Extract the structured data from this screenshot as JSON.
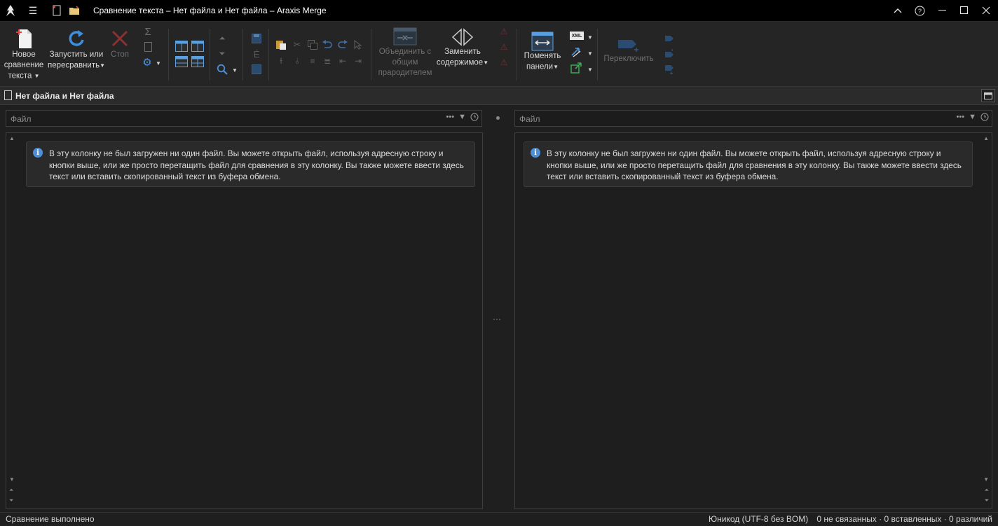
{
  "window": {
    "title": "Сравнение текста – Нет файла и Нет файла – Araxis Merge"
  },
  "ribbon": {
    "new_comparison": "Новое сравнение текста",
    "new_comparison_l1": "Новое",
    "new_comparison_l2": "сравнение",
    "new_comparison_l3": "текста",
    "rerun_l1": "Запустить или",
    "rerun_l2": "пересравнить",
    "stop": "Стоп",
    "merge_l1": "Объединить с",
    "merge_l2": "общим",
    "merge_l3": "прародителем",
    "replace_l1": "Заменить",
    "replace_l2": "содержимое",
    "swap_l1": "Поменять",
    "swap_l2": "панели",
    "switch": "Переключить",
    "xml_badge": "XML"
  },
  "document": {
    "tab_title": "Нет файла и Нет файла"
  },
  "panes": {
    "left": {
      "address_placeholder": "Файл",
      "notice_l1": "В эту колонку не был загружен ни один файл. Вы можете открыть файл, используя адресную строку и",
      "notice_l2": "кнопки выше, или же просто перетащить файл для сравнения в эту колонку. Вы также можете ввести здесь",
      "notice_l3": "текст или вставить скопированный текст из буфера обмена."
    },
    "right": {
      "address_placeholder": "Файл",
      "notice_l1": "В эту колонку не был загружен ни один файл. Вы можете открыть файл, используя адресную строку и",
      "notice_l2": "кнопки выше, или же просто перетащить файл для сравнения в эту колонку. Вы также можете ввести здесь",
      "notice_l3": "текст или вставить скопированный текст из буфера обмена."
    }
  },
  "status": {
    "message": "Сравнение выполнено",
    "encoding": "Юникод (UTF-8 без BOM)",
    "counts": "0 не связанных · 0 вставленных · 0 различий"
  }
}
